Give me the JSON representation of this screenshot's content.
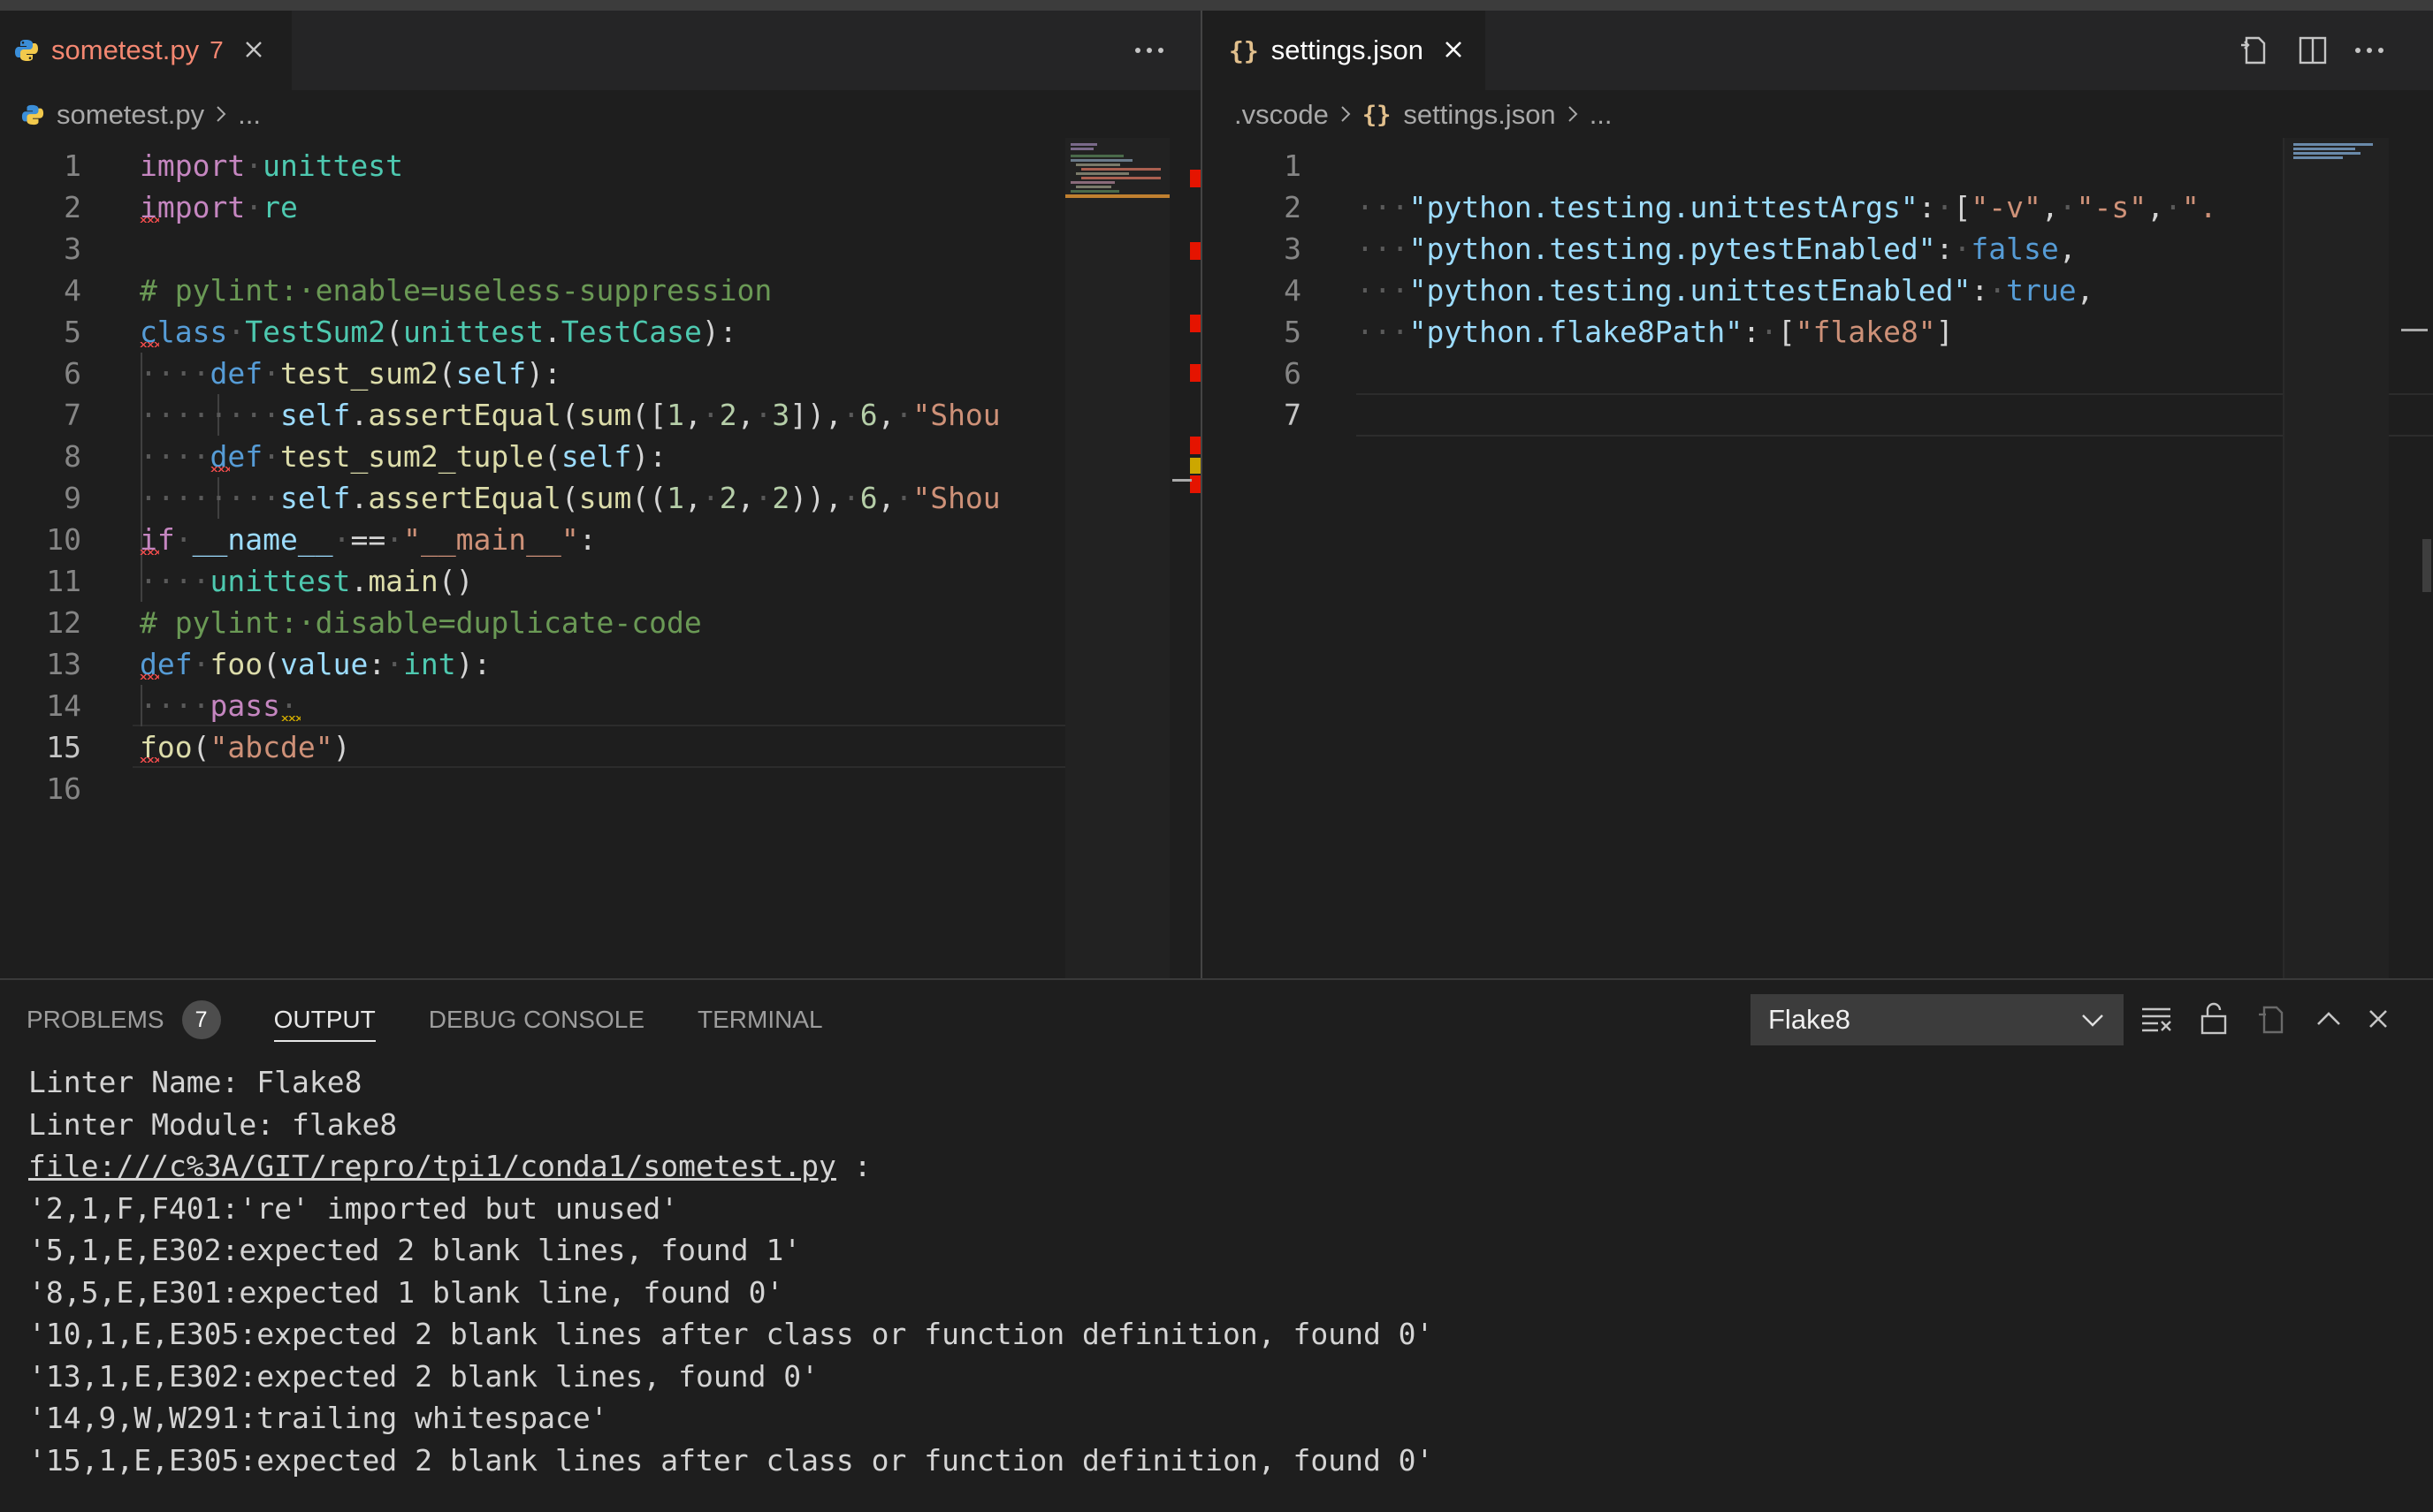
{
  "left_editor": {
    "tab": {
      "filename": "sometest.py",
      "problem_count": "7",
      "icon": "python-icon"
    },
    "more_icon": "ellipsis-icon",
    "breadcrumb": {
      "file": "sometest.py",
      "rest": "..."
    },
    "lines": [
      {
        "n": "1"
      },
      {
        "n": "2"
      },
      {
        "n": "3"
      },
      {
        "n": "4"
      },
      {
        "n": "5"
      },
      {
        "n": "6"
      },
      {
        "n": "7"
      },
      {
        "n": "8"
      },
      {
        "n": "9"
      },
      {
        "n": "10"
      },
      {
        "n": "11"
      },
      {
        "n": "12"
      },
      {
        "n": "13"
      },
      {
        "n": "14"
      },
      {
        "n": "15"
      },
      {
        "n": "16"
      }
    ]
  },
  "right_editor": {
    "tab": {
      "filename": "settings.json",
      "icon": "json-braces-icon"
    },
    "breadcrumb": {
      "folder": ".vscode",
      "file": "settings.json",
      "rest": "..."
    },
    "lines": [
      {
        "n": "1"
      },
      {
        "n": "2"
      },
      {
        "n": "3"
      },
      {
        "n": "4"
      },
      {
        "n": "5"
      },
      {
        "n": "6"
      },
      {
        "n": "7"
      }
    ]
  },
  "panel": {
    "tabs": {
      "problems": "PROBLEMS",
      "problems_count": "7",
      "output": "OUTPUT",
      "debug": "DEBUG CONSOLE",
      "terminal": "TERMINAL"
    },
    "channel": "Flake8",
    "output_lines": [
      "Linter Name: Flake8",
      "Linter Module: flake8",
      "file:///c%3A/GIT/repro/tpi1/conda1/sometest.py",
      "'2,1,F,F401:'re' imported but unused'",
      "'5,1,E,E302:expected 2 blank lines, found 1'",
      "'8,5,E,E301:expected 1 blank line, found 0'",
      "'10,1,E,E305:expected 2 blank lines after class or function definition, found 0'",
      "'13,1,E,E302:expected 2 blank lines, found 0'",
      "'14,9,W,W291:trailing whitespace'",
      "'15,1,E,E305:expected 2 blank lines after class or function definition, found 0'"
    ],
    "link_suffix": " :"
  },
  "colors": {
    "error": "#f14c4c",
    "warning": "#cca700",
    "accent": "#e2c08d"
  }
}
